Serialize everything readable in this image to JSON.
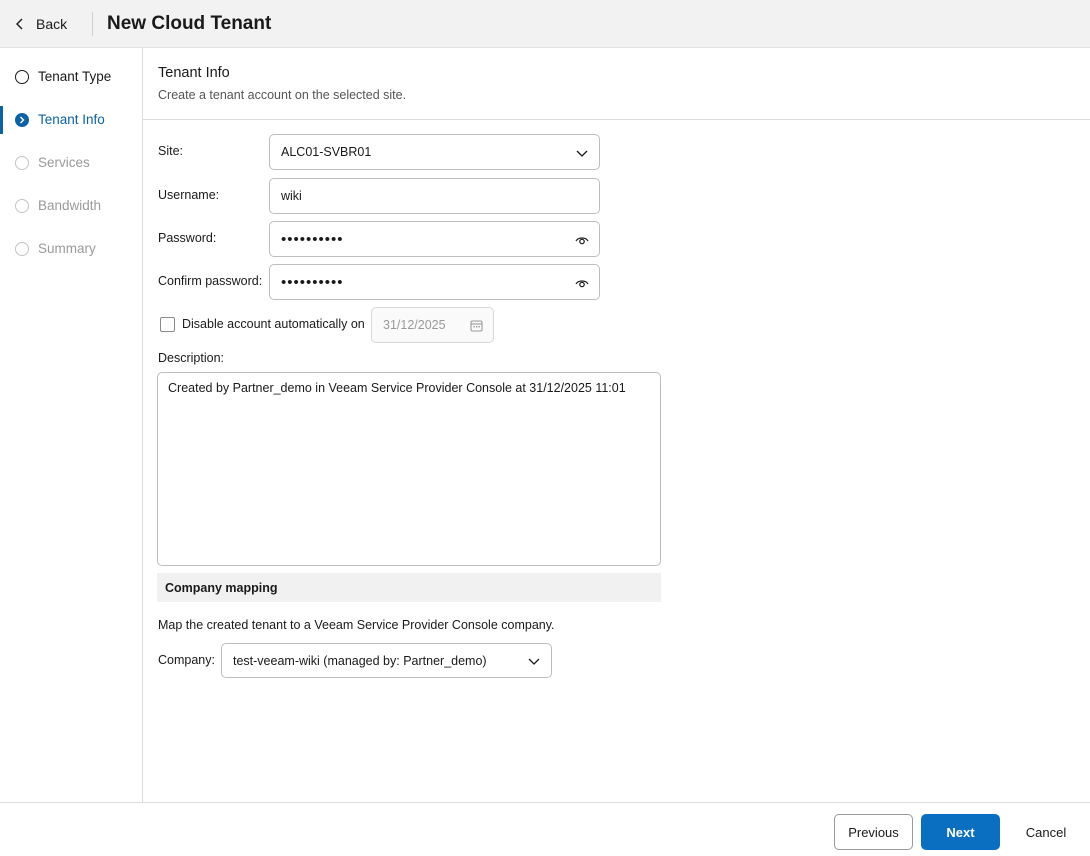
{
  "header": {
    "back_label": "Back",
    "title": "New Cloud Tenant"
  },
  "steps": [
    {
      "label": "Tenant Type",
      "state": "done"
    },
    {
      "label": "Tenant Info",
      "state": "active"
    },
    {
      "label": "Services",
      "state": "pending"
    },
    {
      "label": "Bandwidth",
      "state": "pending"
    },
    {
      "label": "Summary",
      "state": "pending"
    }
  ],
  "section": {
    "title": "Tenant Info",
    "subtitle": "Create a tenant account on the selected site."
  },
  "form": {
    "site_label": "Site:",
    "site_value": "ALC01-SVBR01",
    "username_label": "Username:",
    "username_value": "wiki",
    "password_label": "Password:",
    "password_value": "••••••••••",
    "confirm_label": "Confirm password:",
    "confirm_value": "••••••••••",
    "disable_label": "Disable account automatically on",
    "disable_checked": false,
    "disable_date": "31/12/2025",
    "description_label": "Description:",
    "description_value": "Created by Partner_demo in Veeam Service Provider Console at 31/12/2025 11:01"
  },
  "mapping": {
    "header": "Company mapping",
    "text": "Map the created tenant to a Veeam Service Provider Console company.",
    "company_label": "Company:",
    "company_value": "test-veeam-wiki (managed by: Partner_demo)"
  },
  "footer": {
    "previous_label": "Previous",
    "next_label": "Next",
    "cancel_label": "Cancel"
  },
  "colors": {
    "accent": "#0b62a8",
    "next_button": "#0b6fc1"
  }
}
